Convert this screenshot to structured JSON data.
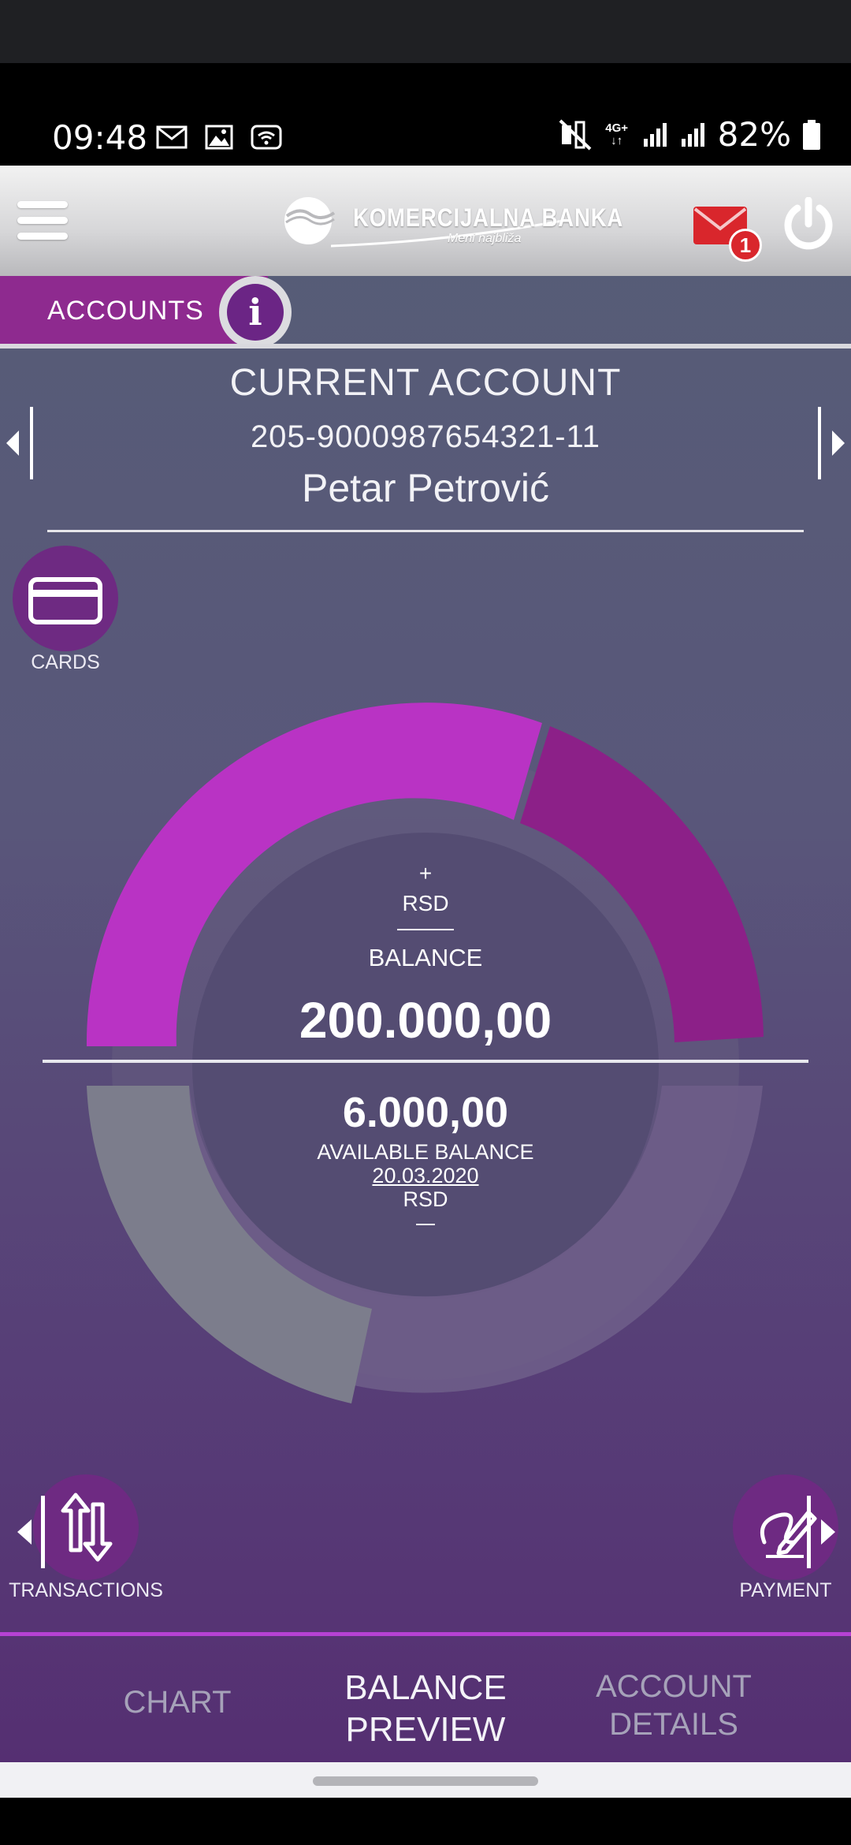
{
  "status_bar": {
    "time": "09:48",
    "battery": "82%",
    "network": "4G+",
    "icons_left": [
      "mail-icon",
      "image-icon",
      "wifi-calling-icon"
    ],
    "icons_right": [
      "mute-icon",
      "network-icon",
      "signal-icon",
      "signal-icon",
      "battery-icon"
    ]
  },
  "app_bar": {
    "brand": "KOMERCIJALNA BANKA",
    "tagline": "Meni najbliža",
    "unread_messages": "1"
  },
  "section": {
    "label": "ACCOUNTS",
    "info_icon": "i"
  },
  "account": {
    "type": "CURRENT ACCOUNT",
    "number": "205-9000987654321-11",
    "owner": "Petar Petrović"
  },
  "actions": {
    "cards_label": "CARDS",
    "transactions_label": "TRANSACTIONS",
    "payment_label": "PAYMENT"
  },
  "balance_widget": {
    "plus_sign": "+",
    "currency_top": "RSD",
    "balance_label": "BALANCE",
    "balance_value": "200.000,00",
    "available_value": "6.000,00",
    "available_label": "AVAILABLE BALANCE",
    "date": "20.03.2020",
    "currency_bottom": "RSD",
    "colors": {
      "bright_segment": "#b933c4",
      "dark_segment": "#8c2088",
      "gray_segment": "#7c7d8c",
      "track": "#6d5b86"
    }
  },
  "bottom_nav": {
    "tabs": [
      {
        "label": "CHART",
        "active": false
      },
      {
        "label": "BALANCE PREVIEW",
        "line1": "BALANCE",
        "line2": "PREVIEW",
        "active": true
      },
      {
        "label": "ACCOUNT DETAILS",
        "line1": "ACCOUNT",
        "line2": "DETAILS",
        "active": false
      }
    ]
  },
  "colors": {
    "accent_purple": "#8e2a8f",
    "mail_red": "#d9262c"
  }
}
